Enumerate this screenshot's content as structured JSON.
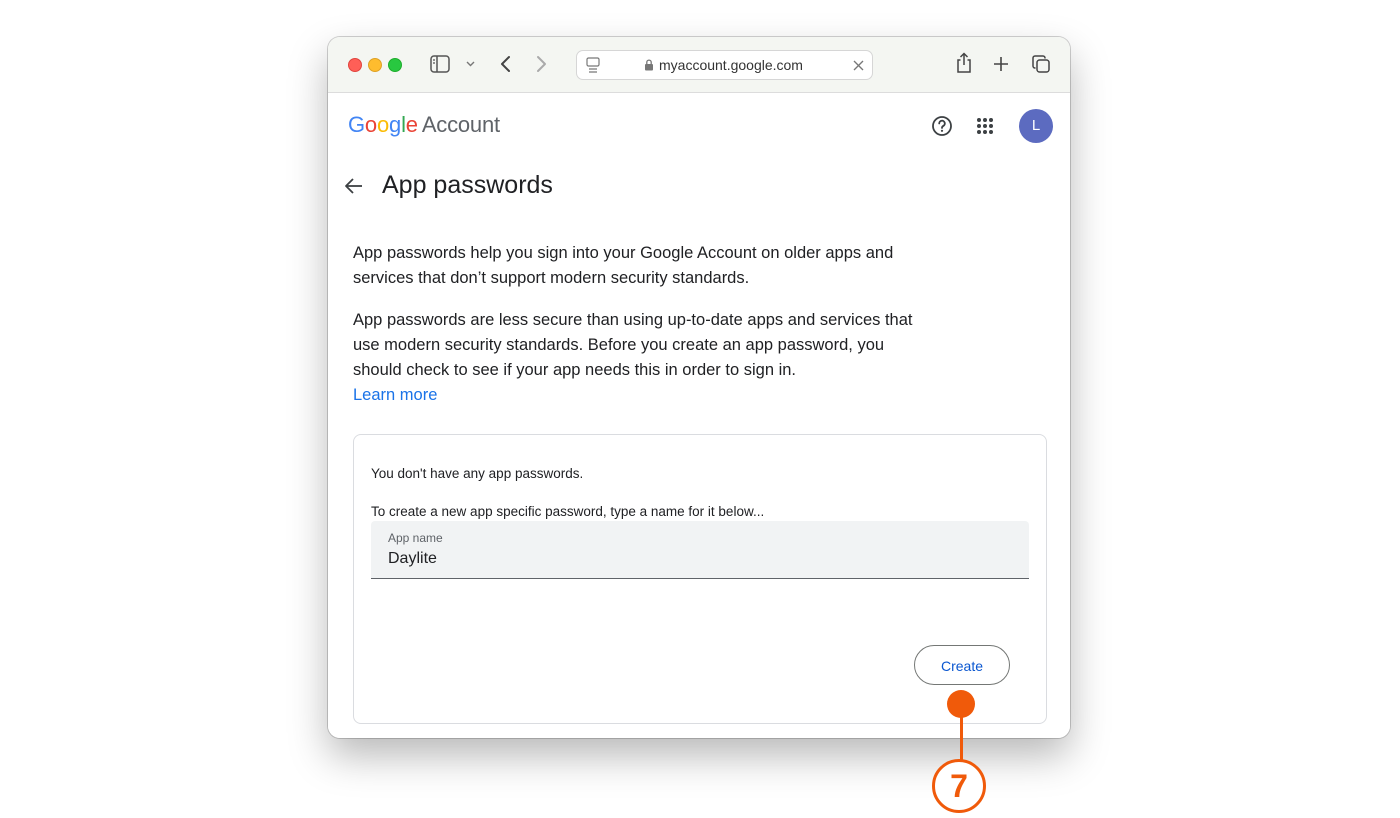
{
  "browser": {
    "url": "myaccount.google.com"
  },
  "header": {
    "logo_google_letters": [
      "G",
      "o",
      "o",
      "g",
      "l",
      "e"
    ],
    "logo_account": "Account",
    "avatar_initial": "L"
  },
  "main": {
    "title": "App passwords",
    "paragraph1": "App passwords help you sign into your Google Account on older apps and services that don’t support modern security standards.",
    "paragraph2": "App passwords are less secure than using up-to-date apps and services that use modern security standards. Before you create an app password, you should check to see if your app needs this in order to sign in.",
    "learn_more": "Learn more"
  },
  "card": {
    "no_passwords": "You don't have any app passwords.",
    "instructions": "To create a new app specific password, type a name for it below...",
    "field_label": "App name",
    "field_value": "Daylite",
    "create_label": "Create"
  },
  "callout": {
    "step_number": "7",
    "color": "#f05a0a"
  },
  "colors": {
    "link": "#1a73e8",
    "button_text": "#0b57d0",
    "avatar_bg": "#5c6bc0"
  }
}
